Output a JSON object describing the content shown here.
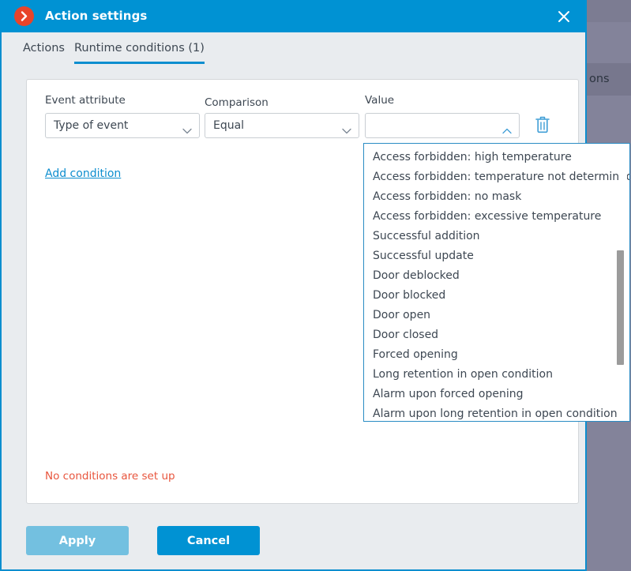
{
  "background": {
    "column_header_fragment": "ons"
  },
  "dialog": {
    "title": "Action settings",
    "title_icon": "chevron-right-circle-icon",
    "close_icon": "close-icon",
    "tabs": [
      {
        "label": "Actions",
        "active": false
      },
      {
        "label": "Runtime conditions (1)",
        "active": true
      }
    ],
    "condition_row": {
      "event_attribute": {
        "label": "Event attribute",
        "value": "Type of event",
        "caret_icon": "chevron-down-icon"
      },
      "comparison": {
        "label": "Comparison",
        "value": "Equal",
        "caret_icon": "chevron-down-icon"
      },
      "value": {
        "label": "Value",
        "value": "",
        "placeholder": "",
        "caret_icon": "chevron-up-icon"
      },
      "delete_icon": "trash-icon"
    },
    "add_condition_label": "Add condition",
    "status_message": "No conditions are set up",
    "buttons": {
      "apply": "Apply",
      "cancel": "Cancel"
    },
    "value_dropdown": {
      "options": [
        "Access forbidden: high temperature",
        "Access forbidden: temperature not determined",
        "Access forbidden: no mask",
        "Access forbidden: excessive temperature",
        "Successful addition",
        "Successful update",
        "Door deblocked",
        "Door blocked",
        "Door open",
        "Door closed",
        "Forced opening",
        "Long retention in open condition",
        "Alarm upon forced opening",
        "Alarm upon long retention in open condition"
      ]
    }
  },
  "colors": {
    "title_bar": "#0092d3",
    "accent": "#0d8ecf",
    "icon_red": "#e8442a",
    "warning_text": "#e8553d",
    "apply_button": "#73c0e0",
    "cancel_button": "#0092d3",
    "backdrop": "#83839a"
  }
}
